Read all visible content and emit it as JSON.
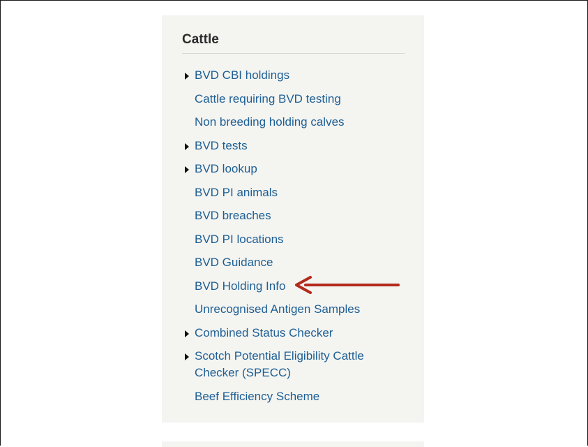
{
  "panel": {
    "title": "Cattle",
    "items": [
      {
        "label": "BVD CBI holdings",
        "expandable": true
      },
      {
        "label": "Cattle requiring BVD testing",
        "expandable": false
      },
      {
        "label": "Non breeding holding calves",
        "expandable": false
      },
      {
        "label": "BVD tests",
        "expandable": true
      },
      {
        "label": "BVD lookup",
        "expandable": true
      },
      {
        "label": "BVD PI animals",
        "expandable": false
      },
      {
        "label": "BVD breaches",
        "expandable": false
      },
      {
        "label": "BVD PI locations",
        "expandable": false
      },
      {
        "label": "BVD Guidance",
        "expandable": false
      },
      {
        "label": "BVD Holding Info",
        "expandable": false
      },
      {
        "label": "Unrecognised Antigen Samples",
        "expandable": false
      },
      {
        "label": "Combined Status Checker",
        "expandable": true
      },
      {
        "label": "Scotch Potential Eligibility Cattle Checker (SPECC)",
        "expandable": true
      },
      {
        "label": "Beef Efficiency Scheme",
        "expandable": false
      }
    ]
  },
  "annotation": {
    "icon": "arrow-left-icon",
    "target": "BVD Holding Info",
    "color": "#b22a1c"
  },
  "colors": {
    "link": "#1d5f94",
    "panel_bg": "#f4f4f1",
    "title": "#2b2b2b"
  }
}
